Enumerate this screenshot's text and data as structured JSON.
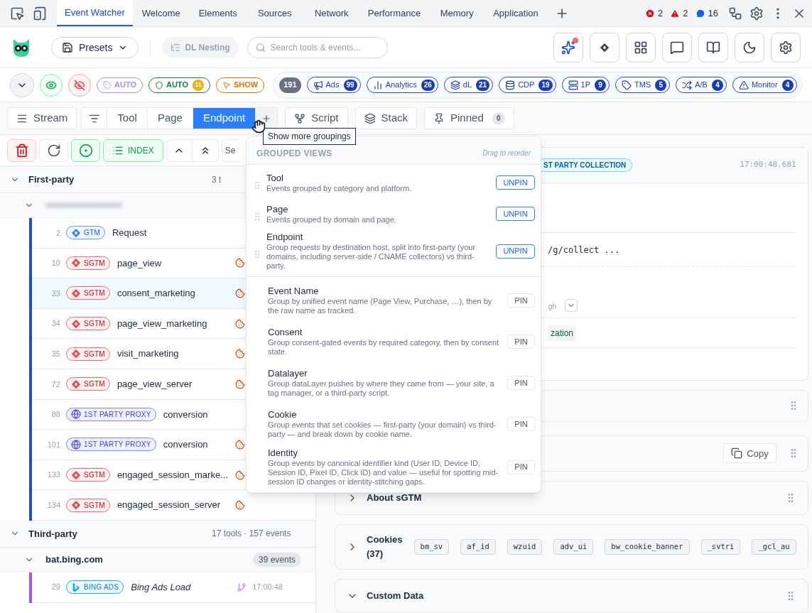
{
  "top_tabs": [
    {
      "label": "Event Watcher",
      "selected": true
    },
    {
      "label": "Welcome",
      "selected": false
    },
    {
      "label": "Elements",
      "selected": false
    },
    {
      "label": "Sources",
      "selected": false
    },
    {
      "label": "Network",
      "selected": false
    },
    {
      "label": "Performance",
      "selected": false
    },
    {
      "label": "Memory",
      "selected": false
    },
    {
      "label": "Application",
      "selected": false
    }
  ],
  "status_counts": [
    {
      "kind": "error",
      "count": "2"
    },
    {
      "kind": "warning",
      "count": "2"
    },
    {
      "kind": "message",
      "count": "16"
    }
  ],
  "header": {
    "presets": "Presets",
    "dl_nesting": {
      "label": "DL Nesting",
      "disabled": true
    },
    "search": {
      "placeholder": "Search tools & events..."
    },
    "assistant_alert": true
  },
  "filters": {
    "eye_on": true,
    "hidden_on": true,
    "modes": [
      {
        "kind": "tag",
        "label": "AUTO",
        "color": "#a78bfa"
      },
      {
        "kind": "shield",
        "label": "AUTO",
        "count": "11",
        "color": "#15803d"
      },
      {
        "kind": "pointer",
        "label": "SHOW",
        "color": "#d97706"
      }
    ],
    "total": "191",
    "categories": [
      {
        "kind": "ads",
        "label": "Ads",
        "count": "99"
      },
      {
        "kind": "analytics",
        "label": "Analytics",
        "count": "26"
      },
      {
        "kind": "dl",
        "label": "dL",
        "count": "21"
      },
      {
        "kind": "cdp",
        "label": "CDP",
        "count": "19"
      },
      {
        "kind": "server",
        "label": "1P",
        "count": "9"
      },
      {
        "kind": "tms",
        "label": "TMS",
        "count": "5"
      },
      {
        "kind": "ab",
        "label": "A/B",
        "count": "4"
      },
      {
        "kind": "monitor",
        "label": "Monitor",
        "count": "4"
      }
    ]
  },
  "views": {
    "stream": "Stream",
    "groupings": [
      {
        "label": "Tool",
        "selected": false
      },
      {
        "label": "Page",
        "selected": false
      },
      {
        "label": "Endpoint",
        "selected": true
      }
    ],
    "script": "Script",
    "stack": "Stack",
    "pinned": {
      "label": "Pinned",
      "count": "0"
    }
  },
  "tooltip": "Show more groupings",
  "groupings_menu": {
    "title": "GROUPED VIEWS",
    "hint": "Drag to reorder",
    "items": [
      {
        "name": "Tool",
        "description": "Events grouped by category and platform.",
        "pinned": true,
        "action": "UNPIN"
      },
      {
        "name": "Page",
        "description": "Events grouped by domain and page.",
        "pinned": true,
        "action": "UNPIN"
      },
      {
        "name": "Endpoint",
        "description": "Group requests by destination host, split into first-party (your domains, including server-side / CNAME collectors) vs third-party.",
        "pinned": true,
        "action": "UNPIN"
      },
      {
        "name": "Event Name",
        "description": "Group by unified event name (Page View, Purchase, …), then by the raw name as tracked.",
        "pinned": false,
        "action": "PIN"
      },
      {
        "name": "Consent",
        "description": "Group consent-gated events by required category, then by consent state.",
        "pinned": false,
        "action": "PIN"
      },
      {
        "name": "Datalayer",
        "description": "Group dataLayer pushes by where they came from — your site, a tag manager, or a third-party script.",
        "pinned": false,
        "action": "PIN"
      },
      {
        "name": "Cookie",
        "description": "Group events that set cookies — first-party (your domain) vs third-party — and break down by cookie name.",
        "pinned": false,
        "action": "PIN"
      },
      {
        "name": "Identity",
        "description": "Group events by canonical identifier kind (User ID, Device ID, Session ID, Pixel ID, Click ID) and value — useful for spotting mid-session ID changes or identity-stitching gaps.",
        "pinned": false,
        "action": "PIN"
      }
    ]
  },
  "list_toolbar": {
    "recording": true,
    "index": "INDEX",
    "search": {
      "placeholder": "Se"
    }
  },
  "groups": [
    {
      "label": "First-party",
      "count": "3 t",
      "expanded": true,
      "hosts": [
        {
          "blurred": true,
          "expanded": true,
          "color": "#1d4ed8",
          "rows": [
            {
              "index": "2",
              "badge": {
                "kind": "gtm",
                "label": "GTM"
              },
              "name": "Request",
              "cookie": false,
              "selected": false
            },
            {
              "index": "10",
              "badge": {
                "kind": "sgtm",
                "label": "SGTM"
              },
              "name": "page_view",
              "cookie": true,
              "selected": false
            },
            {
              "index": "33",
              "badge": {
                "kind": "sgtm",
                "label": "SGTM"
              },
              "name": "consent_marketing",
              "cookie": true,
              "selected": true
            },
            {
              "index": "34",
              "badge": {
                "kind": "sgtm",
                "label": "SGTM"
              },
              "name": "page_view_marketing",
              "cookie": true,
              "selected": false
            },
            {
              "index": "35",
              "badge": {
                "kind": "sgtm",
                "label": "SGTM"
              },
              "name": "visit_marketing",
              "cookie": true,
              "selected": false
            },
            {
              "index": "72",
              "badge": {
                "kind": "sgtm",
                "label": "SGTM"
              },
              "name": "page_view_server",
              "cookie": true,
              "selected": false
            },
            {
              "index": "88",
              "badge": {
                "kind": "proxy",
                "label": "1ST PARTY PROXY"
              },
              "name": "conversion",
              "cookie": false,
              "selected": false
            },
            {
              "index": "101",
              "badge": {
                "kind": "proxy",
                "label": "1ST PARTY PROXY"
              },
              "name": "conversion",
              "cookie": true,
              "selected": false
            },
            {
              "index": "133",
              "badge": {
                "kind": "sgtm",
                "label": "SGTM"
              },
              "name": "engaged_session_marke...",
              "cookie": true,
              "selected": false
            },
            {
              "index": "134",
              "badge": {
                "kind": "sgtm",
                "label": "SGTM"
              },
              "name": "engaged_session_server",
              "cookie": true,
              "selected": false
            }
          ]
        }
      ]
    },
    {
      "label": "Third-party",
      "count": "17 tools · 157 events",
      "expanded": true,
      "hosts": [
        {
          "label": "bat.bing.com",
          "count": "39 events",
          "expanded": true,
          "color": "#a855f7",
          "rows": [
            {
              "index": "29",
              "badge": {
                "kind": "bing",
                "label": "BING ADS"
              },
              "name": "Bing Ads Load",
              "italic": true,
              "cookie": false,
              "branch": true,
              "time": "17:00:48",
              "selected": false
            }
          ]
        }
      ]
    }
  ],
  "detail": {
    "badge": "ST PARTY COLLECTION",
    "time": "17:00:48.681",
    "url": "/g/collect ...",
    "field_fragment": "gh",
    "chip": "zation",
    "sections": [
      {
        "kind": "blank"
      },
      {
        "kind": "copy",
        "button": "Copy"
      },
      {
        "kind": "text",
        "title": "About sGTM",
        "expanded": false
      },
      {
        "kind": "cookies",
        "title": "Cookies",
        "count": "(37)",
        "expanded": false,
        "chips": [
          "bm_sv",
          "af_id",
          "wzuid",
          "adv_ui",
          "bw_cookie_banner",
          "_svtri",
          "_gcl_au"
        ]
      },
      {
        "kind": "text",
        "title": "Custom Data",
        "expanded": true
      }
    ]
  }
}
